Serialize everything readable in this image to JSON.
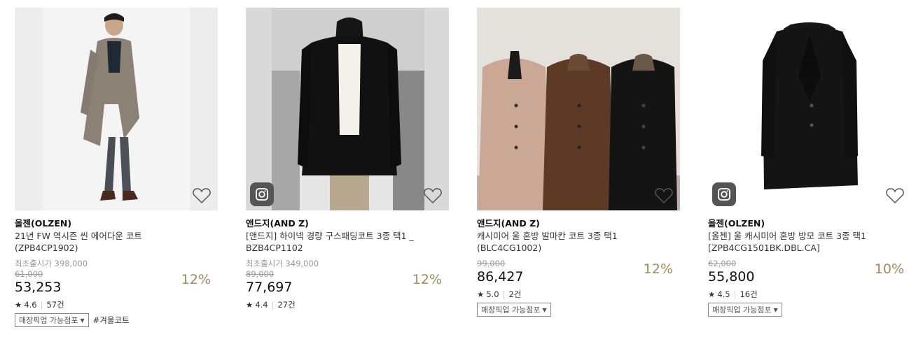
{
  "products": [
    {
      "brand": "올젠(OLZEN)",
      "name_line1": "21년 FW 역시즌 씬 에어다운 코트",
      "name_line2": "(ZPB4CP1902)",
      "release_label": "최초출시가 398,000",
      "original_price": "61,000",
      "price": "53,253",
      "discount": "12%",
      "rating": "4.6",
      "review_count": "57건",
      "pickup_label": "매장픽업 가능점포",
      "tag": "#겨울코트",
      "heart_icon": "heart-outline-icon"
    },
    {
      "brand": "앤드지(AND Z)",
      "name_line1": "[앤드지] 하이넥 경량 구스패딩코트 3종 택1 _",
      "name_line2": "BZB4CP1102",
      "release_label": "최초출시가 349,000",
      "original_price": "89,000",
      "price": "77,697",
      "discount": "12%",
      "rating": "4.4",
      "review_count": "27건",
      "instagram_icon": "instagram-icon",
      "heart_icon": "heart-outline-icon"
    },
    {
      "brand": "앤드지(AND Z)",
      "name_line1": "캐시미어 울 혼방 발마칸 코트 3종 택1",
      "name_line2": "(BLC4CG1002)",
      "original_price": "99,000",
      "price": "86,427",
      "discount": "12%",
      "rating": "5.0",
      "review_count": "2건",
      "pickup_label": "매장픽업 가능점포",
      "heart_icon": "heart-outline-icon"
    },
    {
      "brand": "올젠(OLZEN)",
      "name_line1": "[올젠] 울 캐시미어 혼방 방모 코트 3종 택1",
      "name_line2": "[ZPB4CG1501BK.DBL.CA]",
      "original_price": "62,000",
      "price": "55,800",
      "discount": "10%",
      "rating": "4.5",
      "review_count": "16건",
      "pickup_label": "매장픽업 가능점포",
      "instagram_icon": "instagram-icon",
      "heart_icon": "heart-outline-icon"
    }
  ],
  "colors": {
    "discount": "#a08a5c",
    "strike": "#999999",
    "text": "#222222"
  }
}
